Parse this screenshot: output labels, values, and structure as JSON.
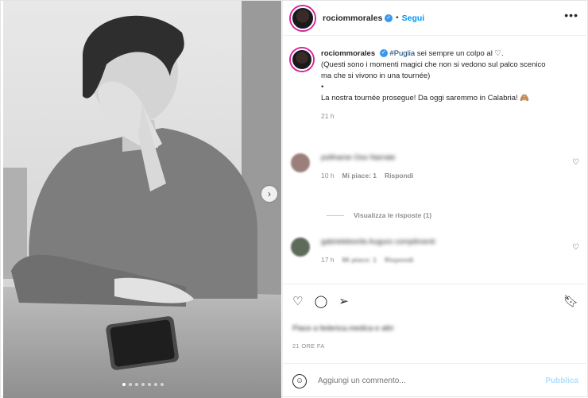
{
  "post": {
    "username": "rociommorales",
    "follow_label": "Segui",
    "separator": "•",
    "more_icon": "more-icon"
  },
  "caption": {
    "username": "rociommorales",
    "hashtag": "#Puglia",
    "line1": "sei sempre un colpo al ♡.",
    "line2": "(Questi sono i momenti magici che non si vedono sul palco scenico",
    "line3": "ma che si vivono in una tournée)",
    "bullet": "•",
    "line4": "La nostra tournée prosegue! Da oggi saremmo in Calabria! 🙈",
    "time": "21 h"
  },
  "comments": [
    {
      "text": "polihame Ooo Narrate",
      "time": "10 h",
      "likes": "Mi piace: 1",
      "reply": "Rispondi"
    },
    {
      "text": "gabrielebonfa Auguro complimenti",
      "time": "17 h",
      "likes": "Mi piace: 1",
      "reply": "Rispondi"
    }
  ],
  "view_replies": "Visualizza le risposte (1)",
  "actions": {
    "liked_by": "Piace a federica.medica e altri",
    "posted": "21 ORE FA"
  },
  "add_comment": {
    "placeholder": "Aggiungi un commento...",
    "publish": "Pubblica"
  },
  "colors": {
    "accent": "#0095f6",
    "verified": "#3897f0",
    "muted": "#8e8e8e"
  }
}
